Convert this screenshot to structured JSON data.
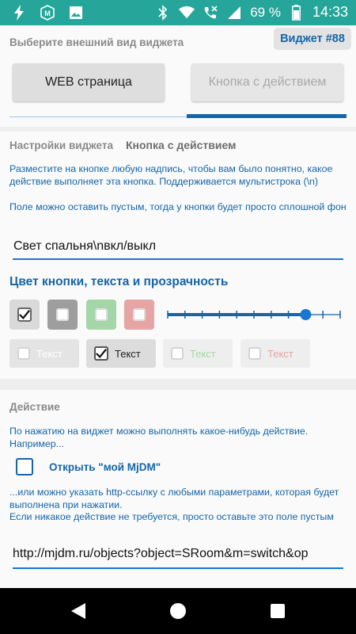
{
  "status_bar": {
    "battery_percent": "69 %",
    "time": "14:33",
    "background": "#26a69a",
    "icons": [
      "flash-icon",
      "mjdm-app-icon",
      "image-icon",
      "bluetooth-icon",
      "wifi-icon",
      "no-call-icon",
      "signal-icon",
      "battery-icon"
    ]
  },
  "header": {
    "label": "Выберите внешний вид виджета",
    "badge": "Виджет #88"
  },
  "tabs": [
    {
      "label": "WEB страница",
      "selected": false
    },
    {
      "label": "Кнопка с действием",
      "selected": true
    }
  ],
  "settings": {
    "label": "Настройки виджета",
    "mode": "Кнопка с действием",
    "info1": "Разместите на кнопке любую надпись, чтобы вам было понятно, какое действие выполняет эта кнопка. Поддерживается мультистрока (\\n)",
    "info2": "Поле можно оставить пустым, тогда у кнопки будет просто сплошной фон",
    "button_text": "Свет спальня\\nвкл/выкл",
    "color_heading": "Цвет кнопки, текста и прозрачность",
    "button_colors": [
      {
        "color": "#d9d9d9",
        "checked": true
      },
      {
        "color": "#9e9e9e",
        "checked": false
      },
      {
        "color": "#a5d6a7",
        "checked": false
      },
      {
        "color": "#e6a4a4",
        "checked": false
      }
    ],
    "transparency_level": 0.8,
    "text_colors": [
      {
        "label": "Текст",
        "color": "#ffffff",
        "checked": false
      },
      {
        "label": "Текст",
        "color": "#222222",
        "checked": true
      },
      {
        "label": "Текст",
        "color": "#a5d6a7",
        "checked": false
      },
      {
        "label": "Текст",
        "color": "#e6a4a4",
        "checked": false
      }
    ]
  },
  "action": {
    "label": "Действие",
    "info3": "По нажатию на виджет можно выполнять какое-нибудь действие. Например...",
    "open_label": "Открыть \"мой MjDM\"",
    "open_checked": false,
    "info4": "...или можно указать http-ссылку с любыми параметрами, которая будет выполнена при нажатии.\nЕсли никакое действие не требуется, просто оставьте это поле пустым",
    "url": "http://mjdm.ru/objects?object=SRoom&m=switch&op"
  },
  "colors": {
    "accent": "#1565a8",
    "underline": "#1976d2"
  }
}
